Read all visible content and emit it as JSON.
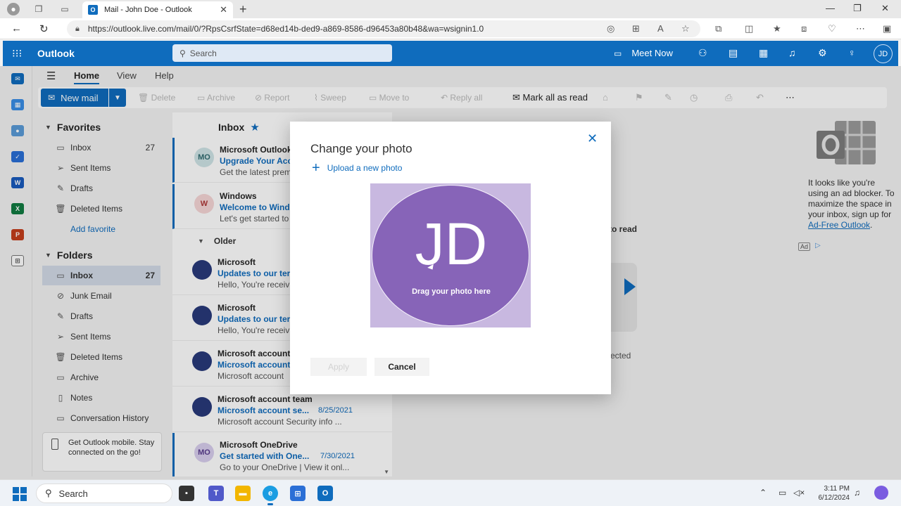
{
  "browser": {
    "tab_title": "Mail - John Doe - Outlook",
    "tab_favicon": "O",
    "url": "https://outlook.live.com/mail/0/?RpsCsrfState=d68ed14b-ded9-a869-8586-d96453a80b48&wa=wsignin1.0"
  },
  "header": {
    "brand": "Outlook",
    "search_placeholder": "Search",
    "meet_now": "Meet Now",
    "avatar_initials": "JD"
  },
  "ribbon": {
    "tabs": [
      "Home",
      "View",
      "Help"
    ],
    "new_mail": "New mail",
    "disabled_actions": [
      "Delete",
      "Archive",
      "Report",
      "Sweep",
      "Move to",
      "Reply all"
    ],
    "mark_all_read": "Mark all as read"
  },
  "folders": {
    "favorites_title": "Favorites",
    "favorites": [
      {
        "label": "Inbox",
        "count": "27",
        "icon": "inbox-icon"
      },
      {
        "label": "Sent Items",
        "count": "",
        "icon": "send-icon"
      },
      {
        "label": "Drafts",
        "count": "",
        "icon": "pencil-icon"
      },
      {
        "label": "Deleted Items",
        "count": "",
        "icon": "trash-icon"
      }
    ],
    "add_favorite": "Add favorite",
    "folders_title": "Folders",
    "items": [
      {
        "label": "Inbox",
        "count": "27",
        "icon": "inbox-icon"
      },
      {
        "label": "Junk Email",
        "count": "",
        "icon": "junk-icon"
      },
      {
        "label": "Drafts",
        "count": "",
        "icon": "pencil-icon"
      },
      {
        "label": "Sent Items",
        "count": "",
        "icon": "send-icon"
      },
      {
        "label": "Deleted Items",
        "count": "",
        "icon": "trash-icon"
      },
      {
        "label": "Archive",
        "count": "",
        "icon": "archive-icon"
      },
      {
        "label": "Notes",
        "count": "",
        "icon": "notes-icon"
      },
      {
        "label": "Conversation History",
        "count": "",
        "icon": "folder-icon"
      }
    ],
    "mobile_promo": "Get Outlook mobile. Stay connected on the go!"
  },
  "message_list": {
    "title": "Inbox",
    "older_label": "Older",
    "messages": [
      {
        "initials": "MO",
        "from": "Microsoft Outlook",
        "subject": "Upgrade Your Acc",
        "date": "",
        "preview": "Get the latest prem",
        "avatar_color": "#cfe4e6",
        "avatar_text_color": "#2f6b70"
      },
      {
        "initials": "W",
        "from": "Windows",
        "subject": "Welcome to Windo",
        "date": "",
        "preview": "Let's get started to",
        "avatar_color": "#f6d6d6",
        "avatar_text_color": "#b03a3a"
      },
      {
        "initials": "",
        "from": "Microsoft",
        "subject": "Updates to our ter",
        "date": "",
        "preview": "Hello, You're receiv",
        "avatar_color": "#283a7a",
        "avatar_text_color": "#ffffff"
      },
      {
        "initials": "",
        "from": "Microsoft",
        "subject": "Updates to our ter",
        "date": "",
        "preview": "Hello, You're receiv",
        "avatar_color": "#283a7a",
        "avatar_text_color": "#ffffff"
      },
      {
        "initials": "",
        "from": "Microsoft account",
        "subject": "Microsoft account",
        "date": "",
        "preview": "Microsoft account",
        "avatar_color": "#283a7a",
        "avatar_text_color": "#ffffff"
      },
      {
        "initials": "",
        "from": "Microsoft account team",
        "subject": "Microsoft account se...",
        "date": "8/25/2021",
        "preview": "Microsoft account Security info ...",
        "avatar_color": "#283a7a",
        "avatar_text_color": "#ffffff"
      },
      {
        "initials": "MO",
        "from": "Microsoft OneDrive",
        "subject": "Get started with One...",
        "date": "7/30/2021",
        "preview": "Go to your OneDrive | View it onl...",
        "avatar_color": "#d9cfee",
        "avatar_text_color": "#5a3d8f"
      }
    ]
  },
  "reading_pane": {
    "partial_text_1": "to read",
    "partial_text_2": "ected"
  },
  "ad": {
    "text_before_link": "It looks like you're using an ad blocker. To maximize the space in your inbox, sign up for ",
    "link": "Ad-Free Outlook",
    "text_after_link": ".",
    "badge": "Ad"
  },
  "dialog": {
    "title": "Change your photo",
    "upload": "Upload a new photo",
    "initials": "JD",
    "drag_text": "Drag your photo here",
    "apply": "Apply",
    "cancel": "Cancel",
    "photo_color": "#8764b8"
  },
  "taskbar": {
    "search": "Search",
    "time": "3:11 PM",
    "date": "6/12/2024"
  }
}
